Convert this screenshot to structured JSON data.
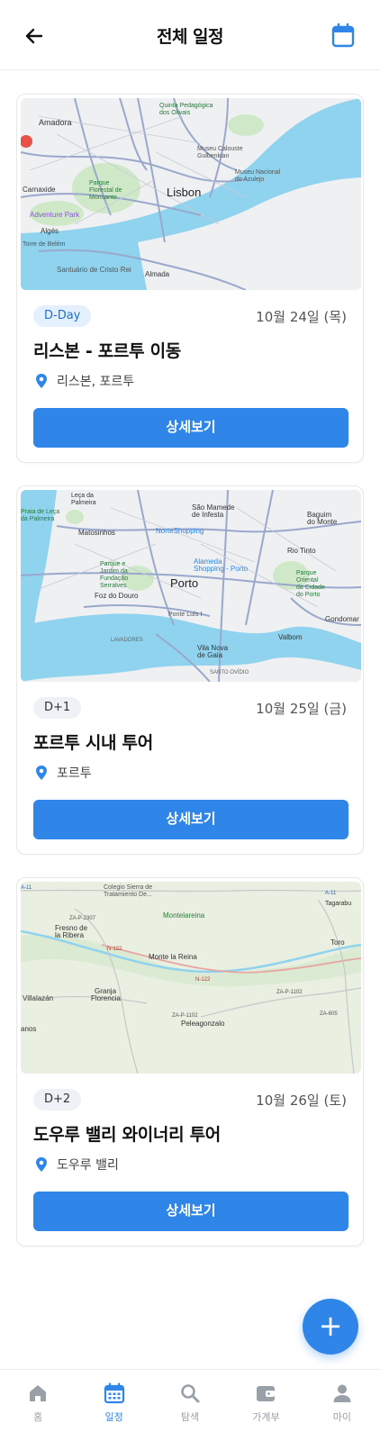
{
  "header": {
    "title": "전체 일정",
    "back_icon": "arrow-left-icon",
    "calendar_icon": "calendar-icon"
  },
  "cards": [
    {
      "badge": "D-Day",
      "date": "10월 24일 (목)",
      "title": "리스본 - 포르투 이동",
      "location": "리스본, 포르투",
      "button": "상세보기",
      "map_labels": [
        "Amadora",
        "Lisbon",
        "Carnaxide",
        "Algés",
        "Almada",
        "Santuário de Cristo Rei",
        "Parque Florestal de Monsanto",
        "Museu Calouste Gulbenkian",
        "Museu Nacional do Azulejo",
        "Adventure Park",
        "Quinta Pedagógica dos Olivais",
        "Torre de Belém"
      ]
    },
    {
      "badge": "D+1",
      "date": "10월 25일 (금)",
      "title": "포르투 시내 투어",
      "location": "포르투",
      "button": "상세보기",
      "map_labels": [
        "Leça da Palmeira",
        "Praia de Leça da Palmeira",
        "Matosinhos",
        "São Mamede de Infesta",
        "NorteShopping",
        "Baguim do Monte",
        "Rio Tinto",
        "Parque e Jardim da Fundação Serralves",
        "Foz do Douro",
        "Porto",
        "Alameda Shopping - Porto",
        "Parque Oriental da Cidade do Porto",
        "Gondomar",
        "Ponte Luís I",
        "Valbom",
        "Vila Nova de Gaia",
        "Lavadores",
        "Santo Ovídio"
      ]
    },
    {
      "badge": "D+2",
      "date": "10월 26일 (토)",
      "title": "도우루 밸리 와이너리 투어",
      "location": "도우루 밸리",
      "button": "상세보기",
      "map_labels": [
        "Colegio Sierra de Tratamiento De...",
        "Fresno de la Ribera",
        "Montelareina",
        "Monte la Reina",
        "Toro",
        "Tagarabu",
        "Villalazán",
        "Granja Florencia",
        "Peleagonzalo",
        "ZA-P-2307",
        "ZA-P-1102",
        "ZA-605",
        "N-122",
        "A-11"
      ]
    }
  ],
  "fab": {
    "label": "+",
    "icon": "plus-icon"
  },
  "nav": [
    {
      "label": "홈",
      "icon": "home-icon",
      "active": false
    },
    {
      "label": "일정",
      "icon": "calendar-icon",
      "active": true
    },
    {
      "label": "탐색",
      "icon": "search-icon",
      "active": false
    },
    {
      "label": "가계부",
      "icon": "wallet-icon",
      "active": false
    },
    {
      "label": "마이",
      "icon": "person-icon",
      "active": false
    }
  ],
  "colors": {
    "primary": "#2f86e8",
    "water": "#8fd3ee",
    "land": "#eef0f2",
    "park": "#cfe9c8",
    "road": "#8f9ec8",
    "inactive": "#9aa0a8"
  }
}
